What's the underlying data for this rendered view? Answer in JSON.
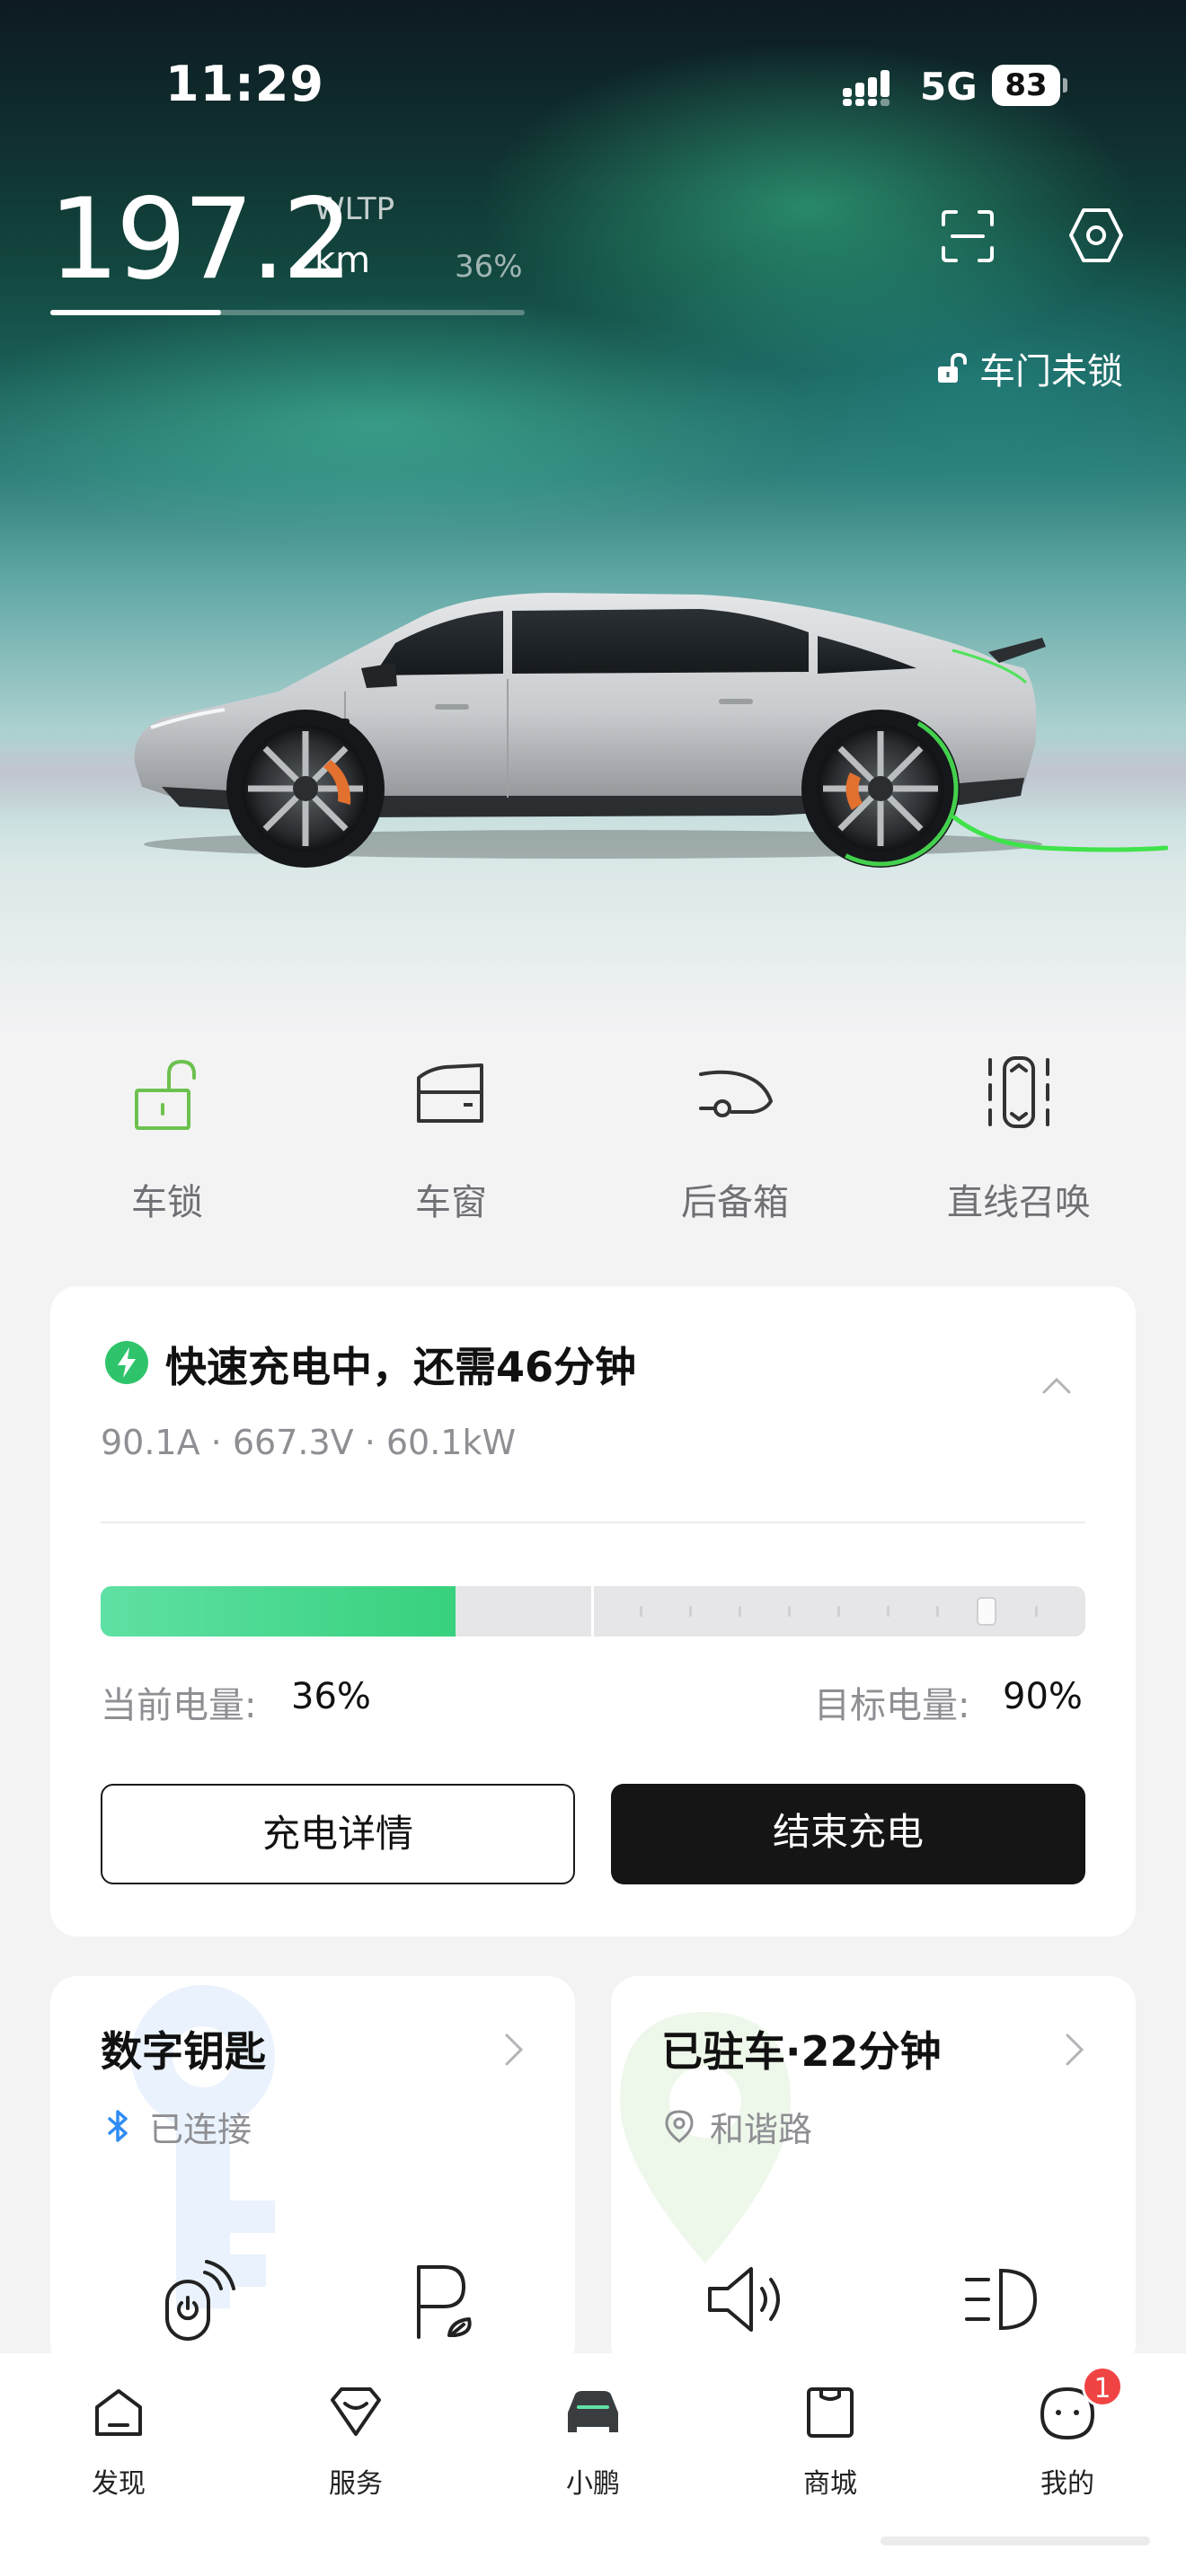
{
  "status_bar": {
    "time": "11:29",
    "network": "5G",
    "battery_level": "83",
    "icons": [
      "signal-icon"
    ]
  },
  "range": {
    "value": "197.2",
    "standard": "WLTP",
    "unit": "km",
    "battery_percent": "36%",
    "bar_fill_fraction": 0.36
  },
  "header_icons": [
    "scan-icon",
    "settings-icon"
  ],
  "door": {
    "status": "车门未锁",
    "icon": "unlocked-icon"
  },
  "quick_controls": [
    {
      "label": "车锁",
      "icon": "lock-open-icon"
    },
    {
      "label": "车窗",
      "icon": "window-icon"
    },
    {
      "label": "后备箱",
      "icon": "trunk-icon"
    },
    {
      "label": "直线召唤",
      "icon": "summon-icon"
    }
  ],
  "charging": {
    "title": "快速充电中，还需46分钟",
    "specs": "90.1A · 667.3V · 60.1kW",
    "current_label": "当前电量:",
    "current_value": "36%",
    "target_label": "目标电量:",
    "target_value": "90%",
    "current_fraction": 0.36,
    "target_fraction": 0.9,
    "details_button": "充电详情",
    "stop_button": "结束充电",
    "accent_color": "#37d17d"
  },
  "digital_key": {
    "title": "数字钥匙",
    "status": "已连接",
    "status_icon": "bluetooth-icon",
    "actions": [
      "remote-start-icon",
      "auto-park-icon"
    ]
  },
  "parking": {
    "title": "已驻车·22分钟",
    "location": "和谐路",
    "location_icon": "location-pin-icon",
    "actions": [
      "horn-icon",
      "headlight-icon"
    ]
  },
  "tabbar": {
    "tabs": [
      {
        "label": "发现",
        "icon": "discover-icon"
      },
      {
        "label": "服务",
        "icon": "service-icon"
      },
      {
        "label": "小鹏",
        "icon": "car-icon",
        "active": true
      },
      {
        "label": "商城",
        "icon": "mall-icon"
      },
      {
        "label": "我的",
        "icon": "profile-icon",
        "badge": "1"
      }
    ]
  }
}
